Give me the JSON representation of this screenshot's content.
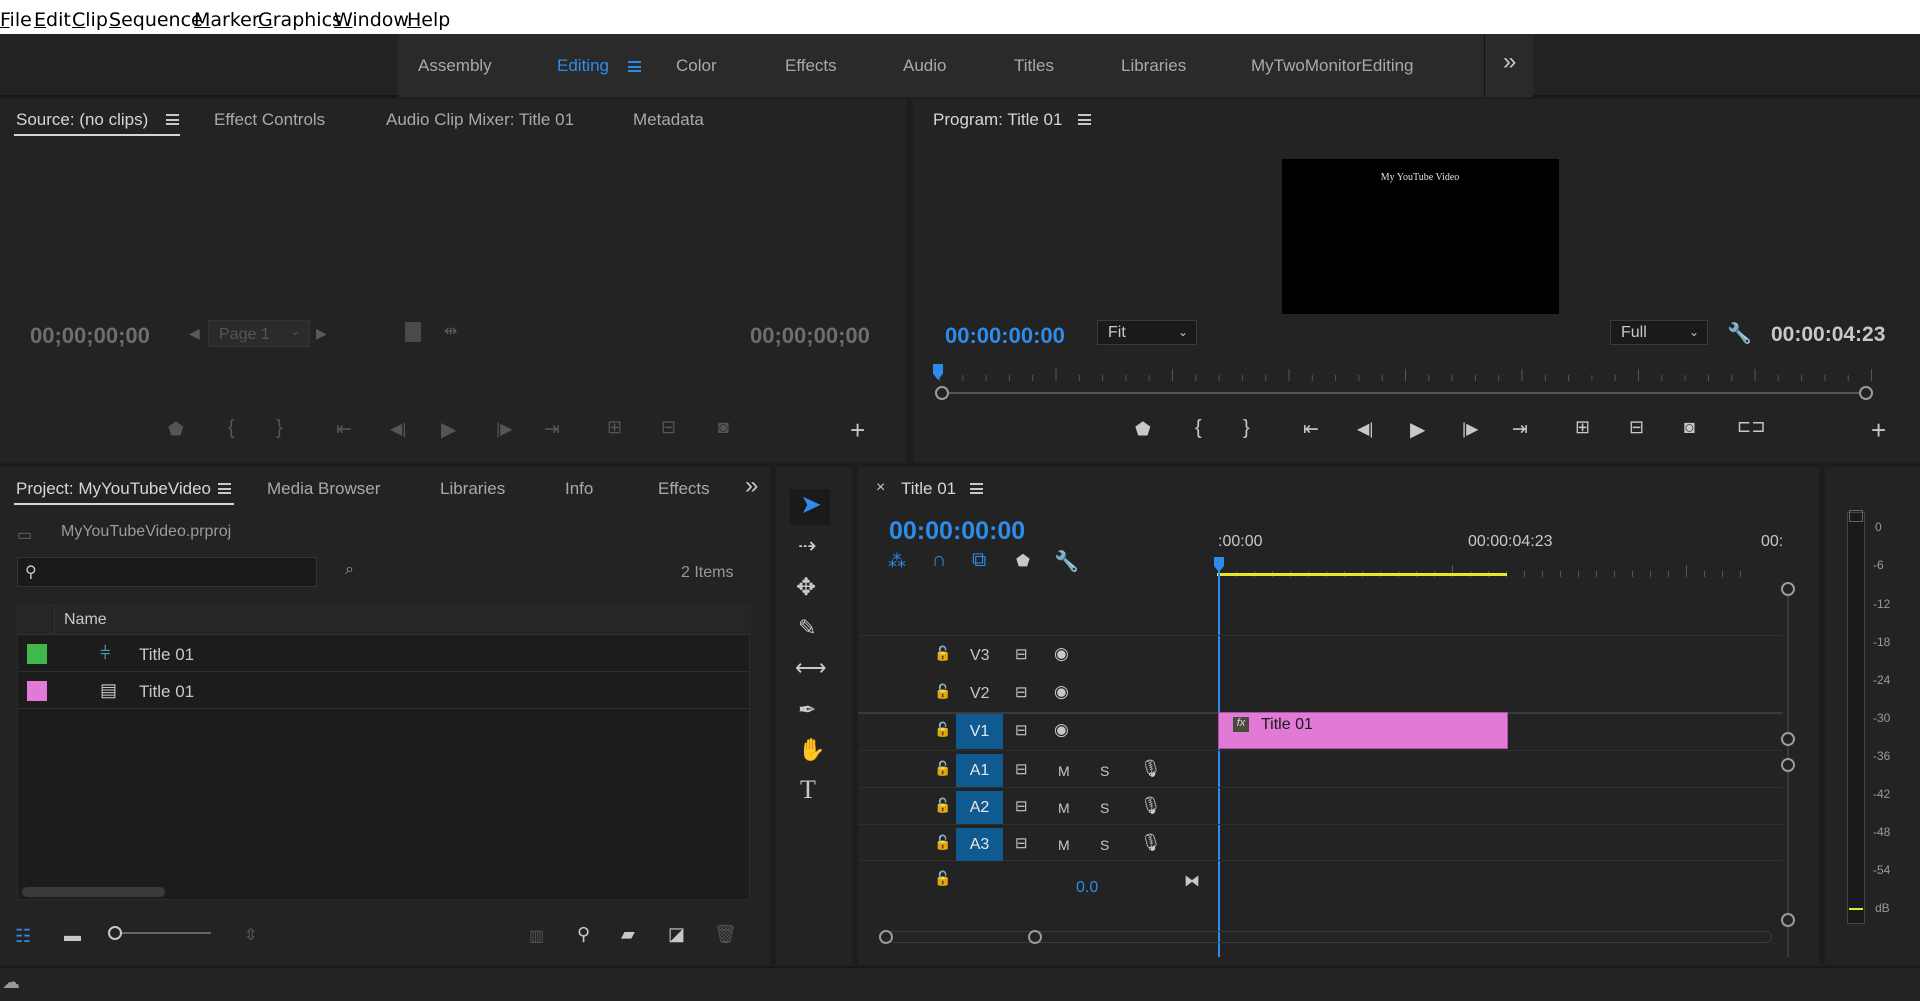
{
  "menu": {
    "items": [
      {
        "label": "File",
        "u": "F"
      },
      {
        "label": "Edit",
        "u": "E"
      },
      {
        "label": "Clip",
        "u": "C"
      },
      {
        "label": "Sequence",
        "u": "S"
      },
      {
        "label": "Marker",
        "u": "M"
      },
      {
        "label": "Graphics",
        "u": "G"
      },
      {
        "label": "Window",
        "u": "W"
      },
      {
        "label": "Help",
        "u": "H"
      }
    ]
  },
  "workspaces": {
    "tabs": [
      "Assembly",
      "Editing",
      "Color",
      "Effects",
      "Audio",
      "Titles",
      "Libraries",
      "MyTwoMonitorEditing"
    ],
    "active": "Editing",
    "overflow": "»"
  },
  "source_panel": {
    "tabs": [
      "Source: (no clips)",
      "Effect Controls",
      "Audio Clip Mixer: Title 01",
      "Metadata"
    ],
    "timecode_in": "00;00;00;00",
    "timecode_out": "00;00;00;00",
    "page_label": "Page 1"
  },
  "program_panel": {
    "title": "Program: Title 01",
    "preview_text": "My YouTube Video",
    "timecode": "00:00:00:00",
    "fit_label": "Fit",
    "quality_label": "Full",
    "duration": "00:00:04:23"
  },
  "project_panel": {
    "tabs": [
      "Project: MyYouTubeVideo",
      "Media Browser",
      "Libraries",
      "Info",
      "Effects"
    ],
    "overflow": "»",
    "file_name": "MyYouTubeVideo.prproj",
    "items_count": "2 Items",
    "column_name": "Name",
    "items": [
      {
        "name": "Title 01",
        "color": "#3fb84c",
        "icon": "sequence-icon"
      },
      {
        "name": "Title 01",
        "color": "#e07ad6",
        "icon": "graphic-icon"
      }
    ]
  },
  "timeline": {
    "title": "Title 01",
    "close": "×",
    "timecode": "00:00:00:00",
    "ruler": [
      ":00:00",
      "00:00:04:23",
      "00:"
    ],
    "video_tracks": [
      "V3",
      "V2",
      "V1"
    ],
    "audio_tracks": [
      "A1",
      "A2",
      "A3"
    ],
    "mute": "M",
    "solo": "S",
    "master_volume": "0.0",
    "clip": {
      "label": "Title 01",
      "fx": "fx",
      "color": "#e07ad6"
    }
  },
  "audio_meter": {
    "labels": [
      "0",
      "-6",
      "-12",
      "-18",
      "-24",
      "-30",
      "-36",
      "-42",
      "-48",
      "-54",
      "dB"
    ]
  },
  "colors": {
    "accent": "#2d8ceb",
    "panel": "#232323",
    "track_active": "#0f5a91",
    "work_area": "#e6e62a"
  }
}
